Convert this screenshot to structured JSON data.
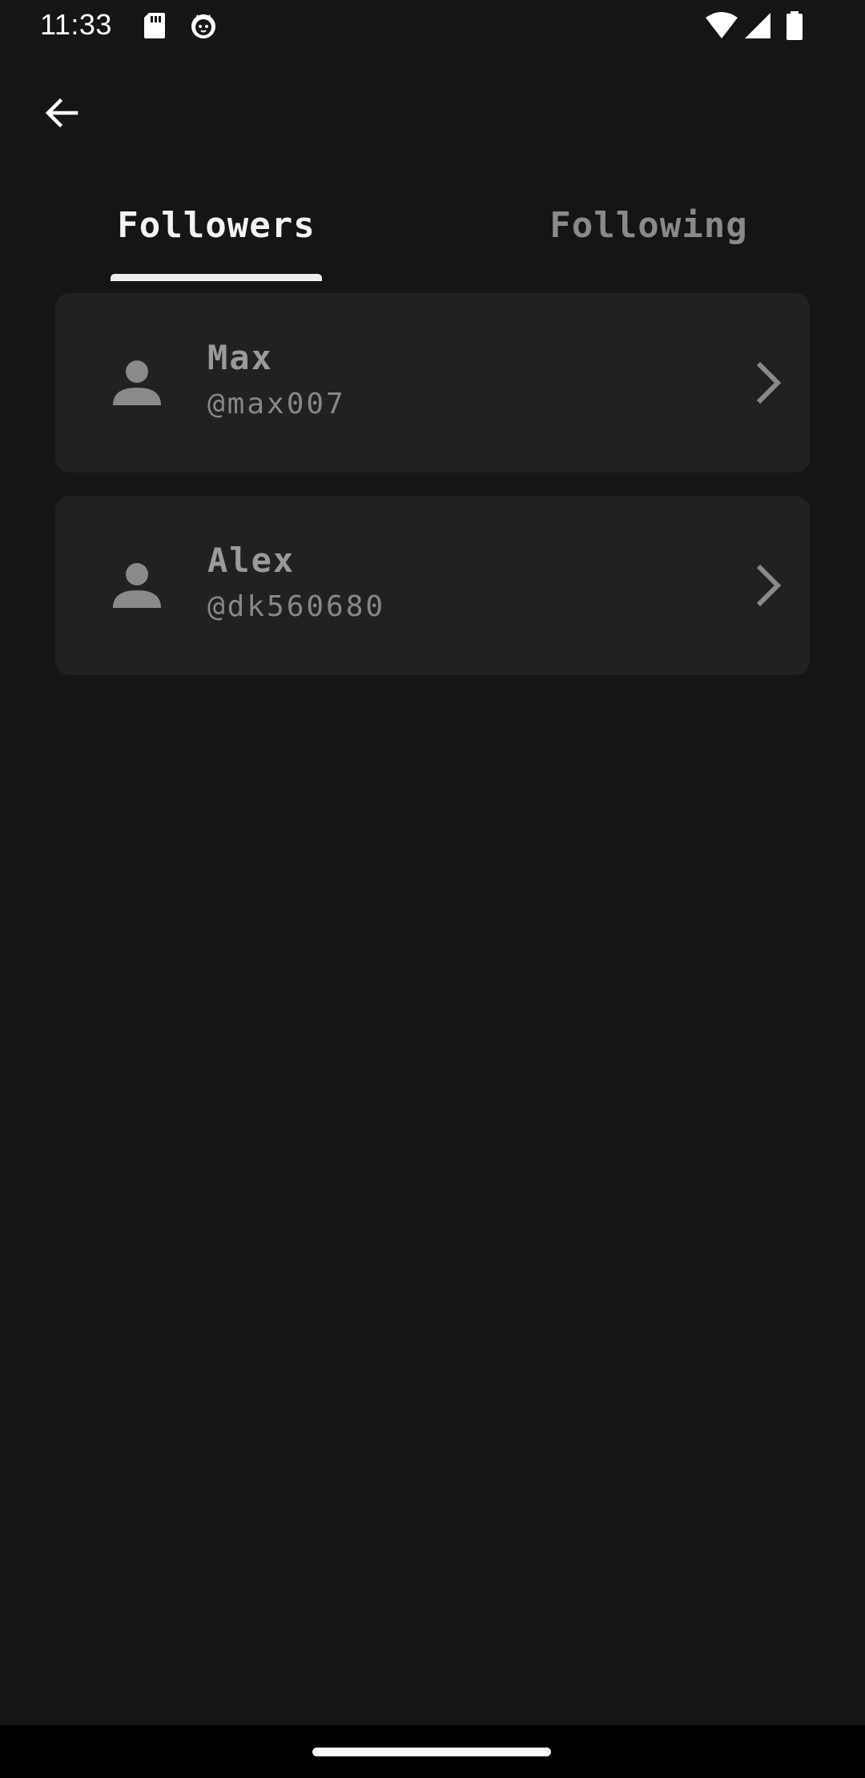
{
  "status_bar": {
    "time": "11:33",
    "icons": [
      "sd-card-icon",
      "cat-app-icon",
      "wifi-icon",
      "cell-signal-icon",
      "battery-icon"
    ]
  },
  "header": {
    "back_icon": "arrow-back-icon"
  },
  "tabs": [
    {
      "label": "Followers",
      "selected": true
    },
    {
      "label": "Following",
      "selected": false
    }
  ],
  "users": [
    {
      "name": "Max",
      "handle": "@max007"
    },
    {
      "name": "Alex",
      "handle": "@dk560680"
    }
  ],
  "colors": {
    "background": "#151515",
    "card": "#212121",
    "tab_active": "#f3f3f3",
    "tab_inactive": "#8a8a8a",
    "text_muted": "#9a9a9a"
  }
}
